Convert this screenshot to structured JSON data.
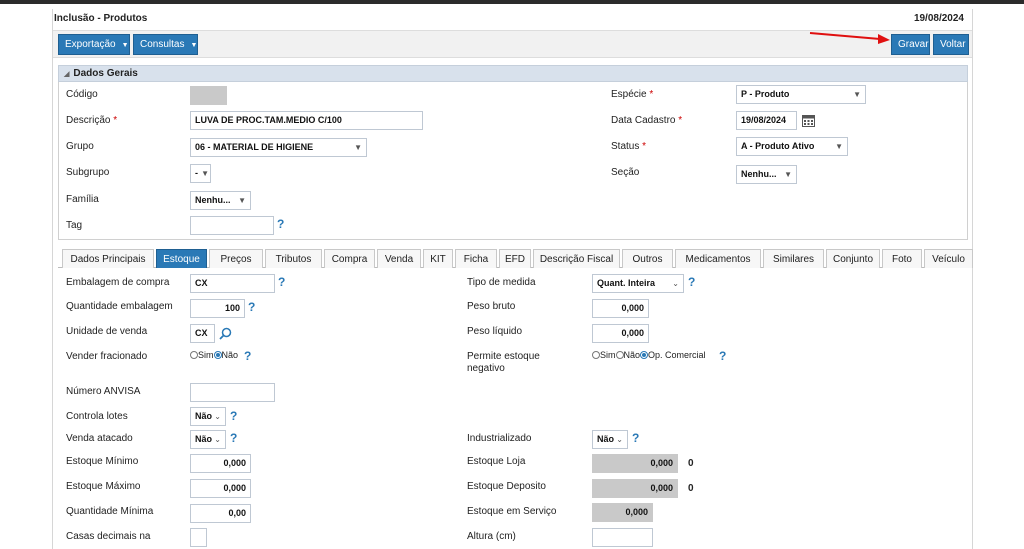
{
  "header": {
    "title": "Inclusão - Produtos",
    "date": "19/08/2024"
  },
  "toolbar": {
    "export_label": "Exportação",
    "query_label": "Consultas",
    "save_label": "Gravar",
    "back_label": "Voltar"
  },
  "section": {
    "title": "Dados Gerais",
    "codigo_label": "Código",
    "codigo_value": "",
    "descricao_label": "Descrição",
    "descricao_value": "LUVA DE PROC.TAM.MEDIO C/100",
    "grupo_label": "Grupo",
    "grupo_value": "06 - MATERIAL DE HIGIENE",
    "subgrupo_label": "Subgrupo",
    "subgrupo_value": "-",
    "familia_label": "Família",
    "familia_value": "Nenhu...",
    "tag_label": "Tag",
    "tag_value": "",
    "especie_label": "Espécie",
    "especie_value": "P - Produto",
    "data_cadastro_label": "Data Cadastro",
    "data_cadastro_value": "19/08/2024",
    "status_label": "Status",
    "status_value": "A - Produto Ativo",
    "secao_label": "Seção",
    "secao_value": "Nenhu...",
    "required_mark": "*"
  },
  "tabs": [
    "Dados Principais",
    "Estoque",
    "Preços",
    "Tributos",
    "Compra",
    "Venda",
    "KIT",
    "Ficha",
    "EFD",
    "Descrição Fiscal",
    "Outros",
    "Medicamentos",
    "Similares",
    "Conjunto",
    "Foto",
    "Veículo"
  ],
  "estoque": {
    "embalagem_compra_label": "Embalagem de compra",
    "embalagem_compra_value": "CX",
    "quantidade_embalagem_label": "Quantidade embalagem",
    "quantidade_embalagem_value": "100",
    "unidade_venda_label": "Unidade de venda",
    "unidade_venda_value": "CX",
    "vender_fracionado_label": "Vender fracionado",
    "sim_label": "Sim",
    "nao_label": "Não",
    "numero_anvisa_label": "Número ANVISA",
    "numero_anvisa_value": "",
    "controla_lotes_label": "Controla lotes",
    "controla_lotes_value": "Não",
    "venda_atacado_label": "Venda atacado",
    "venda_atacado_value": "Não",
    "estoque_minimo_label": "Estoque Mínimo",
    "estoque_minimo_value": "0,000",
    "estoque_maximo_label": "Estoque Máximo",
    "estoque_maximo_value": "0,000",
    "quantidade_minima_label": "Quantidade Mínima",
    "quantidade_minima_value": "0,00",
    "casas_decimais_label": "Casas decimais na",
    "tipo_medida_label": "Tipo de medida",
    "tipo_medida_value": "Quant. Inteira",
    "peso_bruto_label": "Peso bruto",
    "peso_bruto_value": "0,000",
    "peso_liquido_label": "Peso líquido",
    "peso_liquido_value": "0,000",
    "permite_estoque_label_1": "Permite estoque",
    "permite_estoque_label_2": "negativo",
    "op_comercial_label": "Op. Comercial",
    "industrializado_label": "Industrializado",
    "industrializado_value": "Não",
    "estoque_loja_label": "Estoque Loja",
    "estoque_loja_value": "0,000",
    "estoque_loja_extra": "0",
    "estoque_deposito_label": "Estoque Deposito",
    "estoque_deposito_value": "0,000",
    "estoque_deposito_extra": "0",
    "estoque_servico_label": "Estoque em Serviço",
    "estoque_servico_value": "0,000",
    "altura_label": "Altura (cm)"
  },
  "icons": {
    "help": "?",
    "accent": "#2a79b6",
    "arrow_color": "#e01010"
  }
}
